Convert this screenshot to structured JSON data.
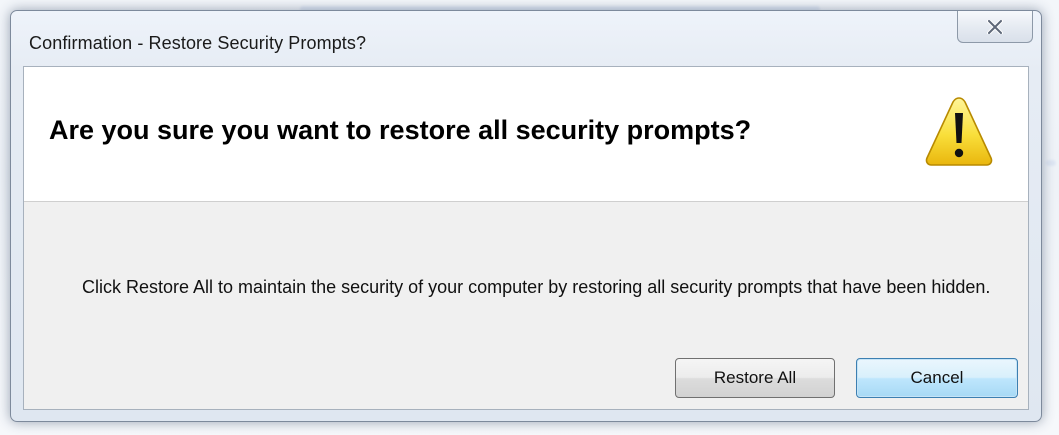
{
  "window": {
    "title": "Confirmation - Restore Security Prompts?",
    "close_icon": "close-icon"
  },
  "dialog": {
    "heading": "Are you sure you want to restore all security prompts?",
    "icon": "warning-icon",
    "message": "Click Restore All to maintain the security of your computer by restoring all security prompts that have been hidden."
  },
  "buttons": {
    "restore_all": "Restore All",
    "cancel": "Cancel"
  },
  "colors": {
    "warning_fill": "#f7d531",
    "cancel_border": "#3c7fb1"
  }
}
